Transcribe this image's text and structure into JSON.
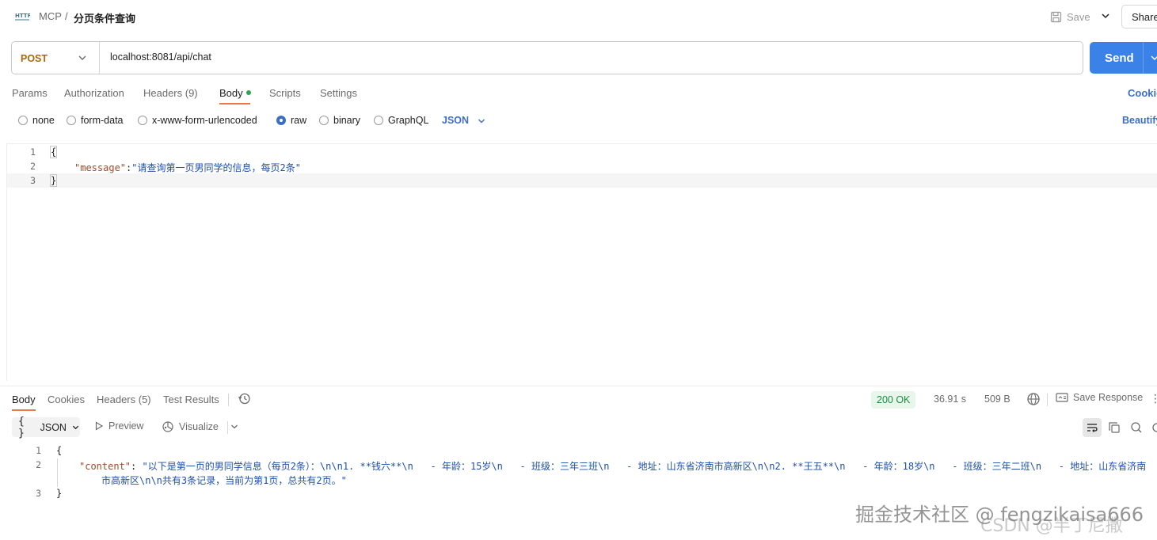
{
  "header": {
    "icon_label": "HTTP",
    "breadcrumb_root": "MCP",
    "breadcrumb_sep": "/",
    "title": "分页条件查询",
    "save_label": "Save",
    "share_label": "Share"
  },
  "request": {
    "method": "POST",
    "url": "localhost:8081/api/chat",
    "send_label": "Send"
  },
  "request_tabs": {
    "params": "Params",
    "authorization": "Authorization",
    "headers": "Headers (9)",
    "body": "Body",
    "scripts": "Scripts",
    "settings": "Settings",
    "cookies": "Cookies"
  },
  "body_types": {
    "none": "none",
    "form_data": "form-data",
    "urlencoded": "x-www-form-urlencoded",
    "raw": "raw",
    "binary": "binary",
    "graphql": "GraphQL",
    "format": "JSON",
    "beautify": "Beautify",
    "selected": "raw"
  },
  "editor": {
    "lines": [
      {
        "num": "1",
        "open": "{"
      },
      {
        "num": "2",
        "key": "\"message\"",
        "colon": ":",
        "value": "\"请查询第一页男同学的信息，每页2条\""
      },
      {
        "num": "3",
        "close": "}"
      }
    ]
  },
  "response_tabs": {
    "body": "Body",
    "cookies": "Cookies",
    "headers": "Headers (5)",
    "test_results": "Test Results"
  },
  "response_meta": {
    "status": "200 OK",
    "time": "36.91 s",
    "size": "509 B",
    "save_response": "Save Response",
    "more": "⋮"
  },
  "response_toolbar": {
    "format_braces": "{ }",
    "format": "JSON",
    "preview": "Preview",
    "visualize": "Visualize"
  },
  "response_body": {
    "line1_num": "1",
    "line1": "{",
    "line2_num": "2",
    "line2_key": "\"content\"",
    "line2_colon": ": ",
    "line2_value": "\"以下是第一页的男同学信息（每页2条）：\\n\\n1. **钱六**\\n   - 年龄：15岁\\n   - 班级：三年三班\\n   - 地址：山东省济南市高新区\\n\\n2. **王五**\\n   - 年龄：18岁\\n   - 班级：三年二班\\n   - 地址：山东省济南",
    "line2_wrap": "市高新区\\n\\n共有3条记录，当前为第1页，总共有2页。\"",
    "line3_num": "3",
    "line3": "}"
  },
  "watermark": {
    "main": "掘金技术社区 @ fengzikaisa666",
    "sub": "CSDN @半丁尼撒"
  }
}
